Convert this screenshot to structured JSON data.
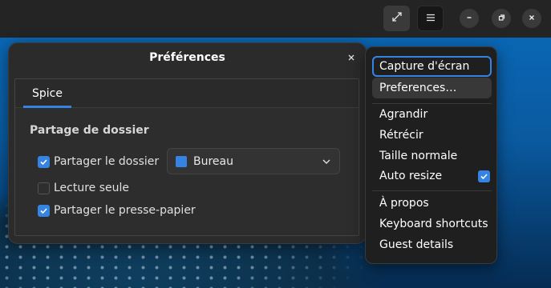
{
  "header": {
    "fullscreen_icon": "fullscreen-icon",
    "menu_icon": "hamburger-menu-icon",
    "window_controls": [
      "minimize-icon",
      "maximize-icon",
      "close-icon"
    ]
  },
  "dialog": {
    "title": "Préférences",
    "tabs": [
      {
        "label": "Spice",
        "selected": true
      }
    ],
    "section_title": "Partage de dossier",
    "share_folder": {
      "label": "Partager le dossier",
      "checked": true
    },
    "folder_dropdown": {
      "value": "Bureau"
    },
    "read_only": {
      "label": "Lecture seule",
      "checked": false
    },
    "share_clipboard": {
      "label": "Partager le presse-papier",
      "checked": true
    }
  },
  "menu": {
    "items": [
      {
        "label": "Capture d'écran"
      },
      {
        "label": "Preferences…"
      },
      {
        "label": "Agrandir"
      },
      {
        "label": "Rétrécir"
      },
      {
        "label": "Taille normale"
      },
      {
        "label": "Auto resize",
        "checked": true
      },
      {
        "label": "À propos"
      },
      {
        "label": "Keyboard shortcuts"
      },
      {
        "label": "Guest details"
      }
    ]
  },
  "colors": {
    "accent": "#3584e4",
    "headerbar": "#242424",
    "dialog_bg": "#2b2b2b",
    "menu_bg": "#1f1f1f"
  }
}
